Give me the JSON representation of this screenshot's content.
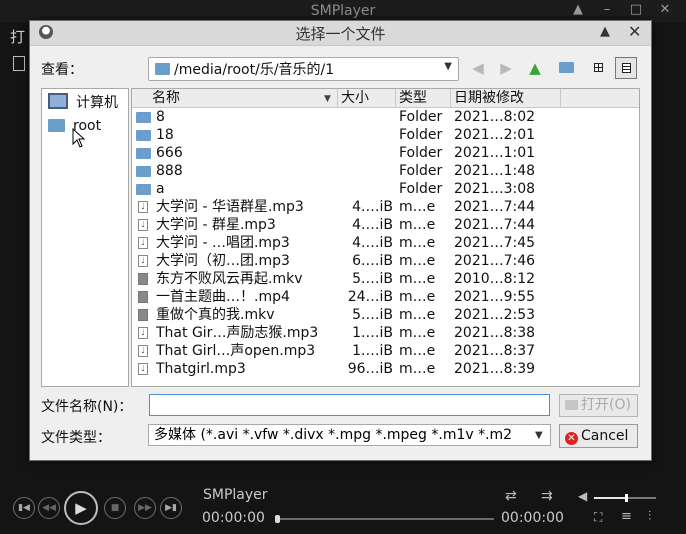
{
  "player": {
    "title": "SMPlayer",
    "menu_partial": "打",
    "media_title": "SMPlayer",
    "time_current": "00:00:00",
    "time_total": "00:00:00",
    "seek_position": 0.0,
    "volume_level": 0.5
  },
  "dialog": {
    "title": "选择一个文件",
    "lookin_label": "查看：",
    "path": "/media/root/乐/音乐的/1",
    "sidebar": [
      {
        "label": "计算机",
        "icon": "computer-icon"
      },
      {
        "label": "root",
        "icon": "folder-icon"
      }
    ],
    "columns": {
      "name": "名称",
      "size": "大小",
      "type": "类型",
      "date": "日期被修改"
    },
    "files": [
      {
        "name": "8",
        "size": "",
        "type": "Folder",
        "date": "2021…8:02",
        "icon": "folder"
      },
      {
        "name": "18",
        "size": "",
        "type": "Folder",
        "date": "2021…2:01",
        "icon": "folder"
      },
      {
        "name": "666",
        "size": "",
        "type": "Folder",
        "date": "2021…1:01",
        "icon": "folder"
      },
      {
        "name": "888",
        "size": "",
        "type": "Folder",
        "date": "2021…1:48",
        "icon": "folder"
      },
      {
        "name": "a",
        "size": "",
        "type": "Folder",
        "date": "2021…3:08",
        "icon": "folder"
      },
      {
        "name": "大学问 - 华语群星.mp3",
        "size": "4.…iB",
        "type": "m…e",
        "date": "2021…7:44",
        "icon": "audio"
      },
      {
        "name": "大学问 - 群星.mp3",
        "size": "4.…iB",
        "type": "m…e",
        "date": "2021…7:44",
        "icon": "audio"
      },
      {
        "name": "大学问 - …唱团.mp3",
        "size": "4.…iB",
        "type": "m…e",
        "date": "2021…7:45",
        "icon": "audio"
      },
      {
        "name": "大学问（初…团.mp3",
        "size": "6.…iB",
        "type": "m…e",
        "date": "2021…7:46",
        "icon": "audio"
      },
      {
        "name": "东方不败风云再起.mkv",
        "size": "5.…iB",
        "type": "m…e",
        "date": "2010…8:12",
        "icon": "video"
      },
      {
        "name": "一首主题曲…！.mp4",
        "size": "24…iB",
        "type": "m…e",
        "date": "2021…9:55",
        "icon": "video"
      },
      {
        "name": "重做个真的我.mkv",
        "size": "5.…iB",
        "type": "m…e",
        "date": "2021…2:53",
        "icon": "video"
      },
      {
        "name": "That Gir…声励志猴.mp3",
        "size": "1.…iB",
        "type": "m…e",
        "date": "2021…8:38",
        "icon": "audio"
      },
      {
        "name": "That Girl…声open.mp3",
        "size": "1.…iB",
        "type": "m…e",
        "date": "2021…8:37",
        "icon": "audio"
      },
      {
        "name": "Thatgirl.mp3",
        "size": "96…iB",
        "type": "m…e",
        "date": "2021…8:39",
        "icon": "audio"
      }
    ],
    "filename_label": "文件名称(N)：",
    "filename_value": "",
    "filetype_label": "文件类型：",
    "filetype_value": "多媒体 (*.avi *.vfw *.divx *.mpg *.mpeg *.m1v *.m2",
    "open_label": "打开(O)",
    "cancel_label": "Cancel"
  },
  "colors": {
    "folder": "#6a9ecb",
    "focus": "#4a90d9",
    "up_arrow": "#3aa43a",
    "cancel_icon": "#dd2222"
  }
}
